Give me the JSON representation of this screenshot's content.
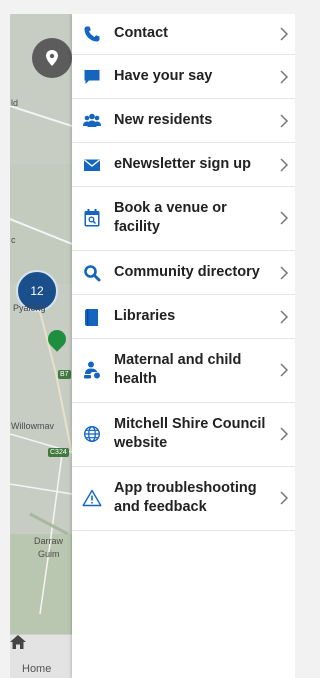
{
  "map": {
    "cluster_count": "12",
    "labels": {
      "partial_top": "ld",
      "partial_mid": "c",
      "pyalong": "Pyalong",
      "willowmavin": "Willowmav",
      "darraweit": "Darraw",
      "guim": "Guim"
    },
    "road_tags": {
      "b75": "B7",
      "c324": "C324"
    }
  },
  "bottom_nav": {
    "home_label": "Home"
  },
  "menu": {
    "items": [
      {
        "label": "Contact",
        "icon": "phone-icon"
      },
      {
        "label": "Have your say",
        "icon": "speech-bubble-icon"
      },
      {
        "label": "New residents",
        "icon": "people-icon"
      },
      {
        "label": "eNewsletter sign up",
        "icon": "envelope-icon"
      },
      {
        "label": "Book a venue or facility",
        "icon": "calendar-search-icon"
      },
      {
        "label": "Community directory",
        "icon": "search-icon"
      },
      {
        "label": "Libraries",
        "icon": "book-icon"
      },
      {
        "label": "Maternal and child health",
        "icon": "mother-child-icon"
      },
      {
        "label": "Mitchell Shire Council website",
        "icon": "globe-icon"
      },
      {
        "label": "App troubleshooting and feedback",
        "icon": "warning-icon"
      }
    ]
  },
  "colors": {
    "accent": "#1565c0",
    "text": "#222222",
    "divider": "#e6e6e6"
  }
}
